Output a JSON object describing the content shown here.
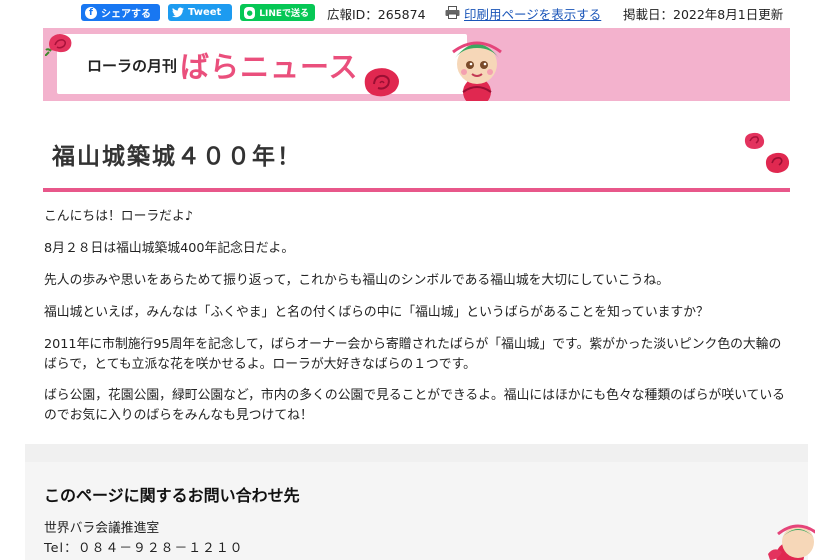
{
  "share": {
    "facebook_label": "シェアする",
    "twitter_label": "Tweet",
    "line_label": "LINEで送る"
  },
  "meta": {
    "id_text": "広報ID：265874",
    "print_link": "印刷用ページを表示する",
    "published": "掲載日：2022年8月1日更新"
  },
  "banner": {
    "subtitle": "ローラの月刊",
    "title": "ばらニュース"
  },
  "page_title": "福山城築城４００年！",
  "paragraphs": [
    "こんにちは！ローラだよ♪",
    "8月２８日は福山城築城400年記念日だよ。",
    "先人の歩みや思いをあらためて振り返って，これからも福山のシンボルである福山城を大切にしていこうね。",
    "福山城といえば，みんなは「ふくやま」と名の付くばらの中に「福山城」というばらがあることを知っていますか？",
    "2011年に市制施行95周年を記念して，ばらオーナー会から寄贈されたばらが「福山城」です。紫がかった淡いピンク色の大輪のばらで，とても立派な花を咲かせるよ。ローラが大好きなばらの１つです。",
    "ばら公園，花園公園，緑町公園など，市内の多くの公園で見ることができるよ。福山にはほかにも色々な種類のばらが咲いているのでお気に入りのばらをみんなも見つけてね！"
  ],
  "contact": {
    "heading": "このページに関するお問い合わせ先",
    "department": "世界バラ会議推進室",
    "tel": "Tel：０８４－９２８－１２１０"
  },
  "colors": {
    "accent_pink": "#e8578a",
    "banner_pink": "#f3b2cd",
    "link_blue": "#1a55b8"
  }
}
